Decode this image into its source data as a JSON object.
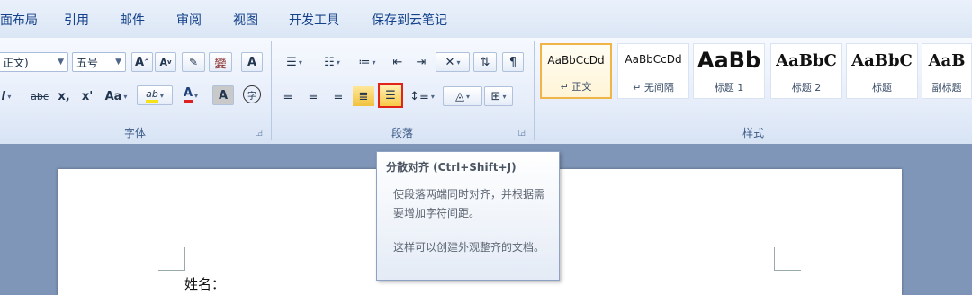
{
  "tabs": [
    "面布局",
    "引用",
    "邮件",
    "审阅",
    "视图",
    "开发工具",
    "保存到云笔记"
  ],
  "font_group": {
    "label": "字体",
    "font_name": "正文)",
    "font_size": "五号",
    "grow_font": "A",
    "shrink_font": "A",
    "phonetic": "變",
    "char_border": "A",
    "strike": "abc",
    "subscript": "x,",
    "superscript": "x'",
    "change_case": "Aa",
    "highlight": "ab",
    "font_color": "A",
    "char_shading": "A",
    "enclose": "字"
  },
  "paragraph_group": {
    "label": "段落"
  },
  "styles_group": {
    "label": "样式",
    "styles": [
      {
        "sample": "AaBbCcDd",
        "name": "↵ 正文",
        "selected": true
      },
      {
        "sample": "AaBbCcDd",
        "name": "↵ 无间隔",
        "selected": false
      },
      {
        "sample": "AaBb",
        "name": "标题 1",
        "selected": false
      },
      {
        "sample": "AaBbC",
        "name": "标题 2",
        "selected": false
      },
      {
        "sample": "AaBbC",
        "name": "标题",
        "selected": false
      },
      {
        "sample": "AaB",
        "name": "副标题",
        "selected": false
      }
    ]
  },
  "tooltip": {
    "title": "分散对齐 (Ctrl+Shift+J)",
    "body": "使段落两端同时对齐，并根据需要增加字符间距。",
    "note": "这样可以创建外观整齐的文档。"
  },
  "document": {
    "text": "姓名："
  },
  "colors": {
    "highlight": "#f5e21b",
    "font_color": "#e02020",
    "selected_style_border": "#f0b548",
    "tooltip_focus": "#e2231a"
  }
}
